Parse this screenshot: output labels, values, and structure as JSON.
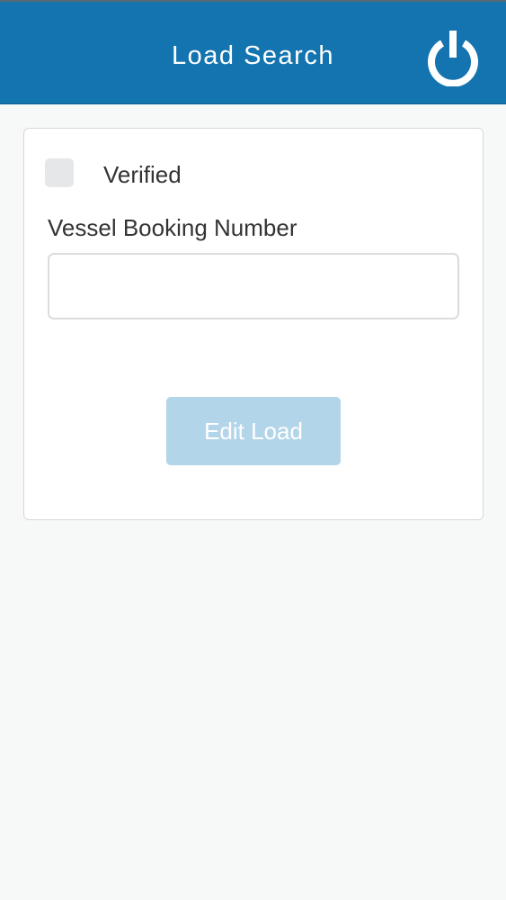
{
  "header": {
    "title": "Load Search",
    "logout_icon": "power-icon",
    "background_color": "#1474b0"
  },
  "form": {
    "verified_checkbox": {
      "label": "Verified",
      "checked": false
    },
    "vessel_booking": {
      "label": "Vessel Booking Number",
      "value": "",
      "placeholder": ""
    },
    "submit_label": "Edit Load",
    "submit_color": "#b3d5ea"
  }
}
